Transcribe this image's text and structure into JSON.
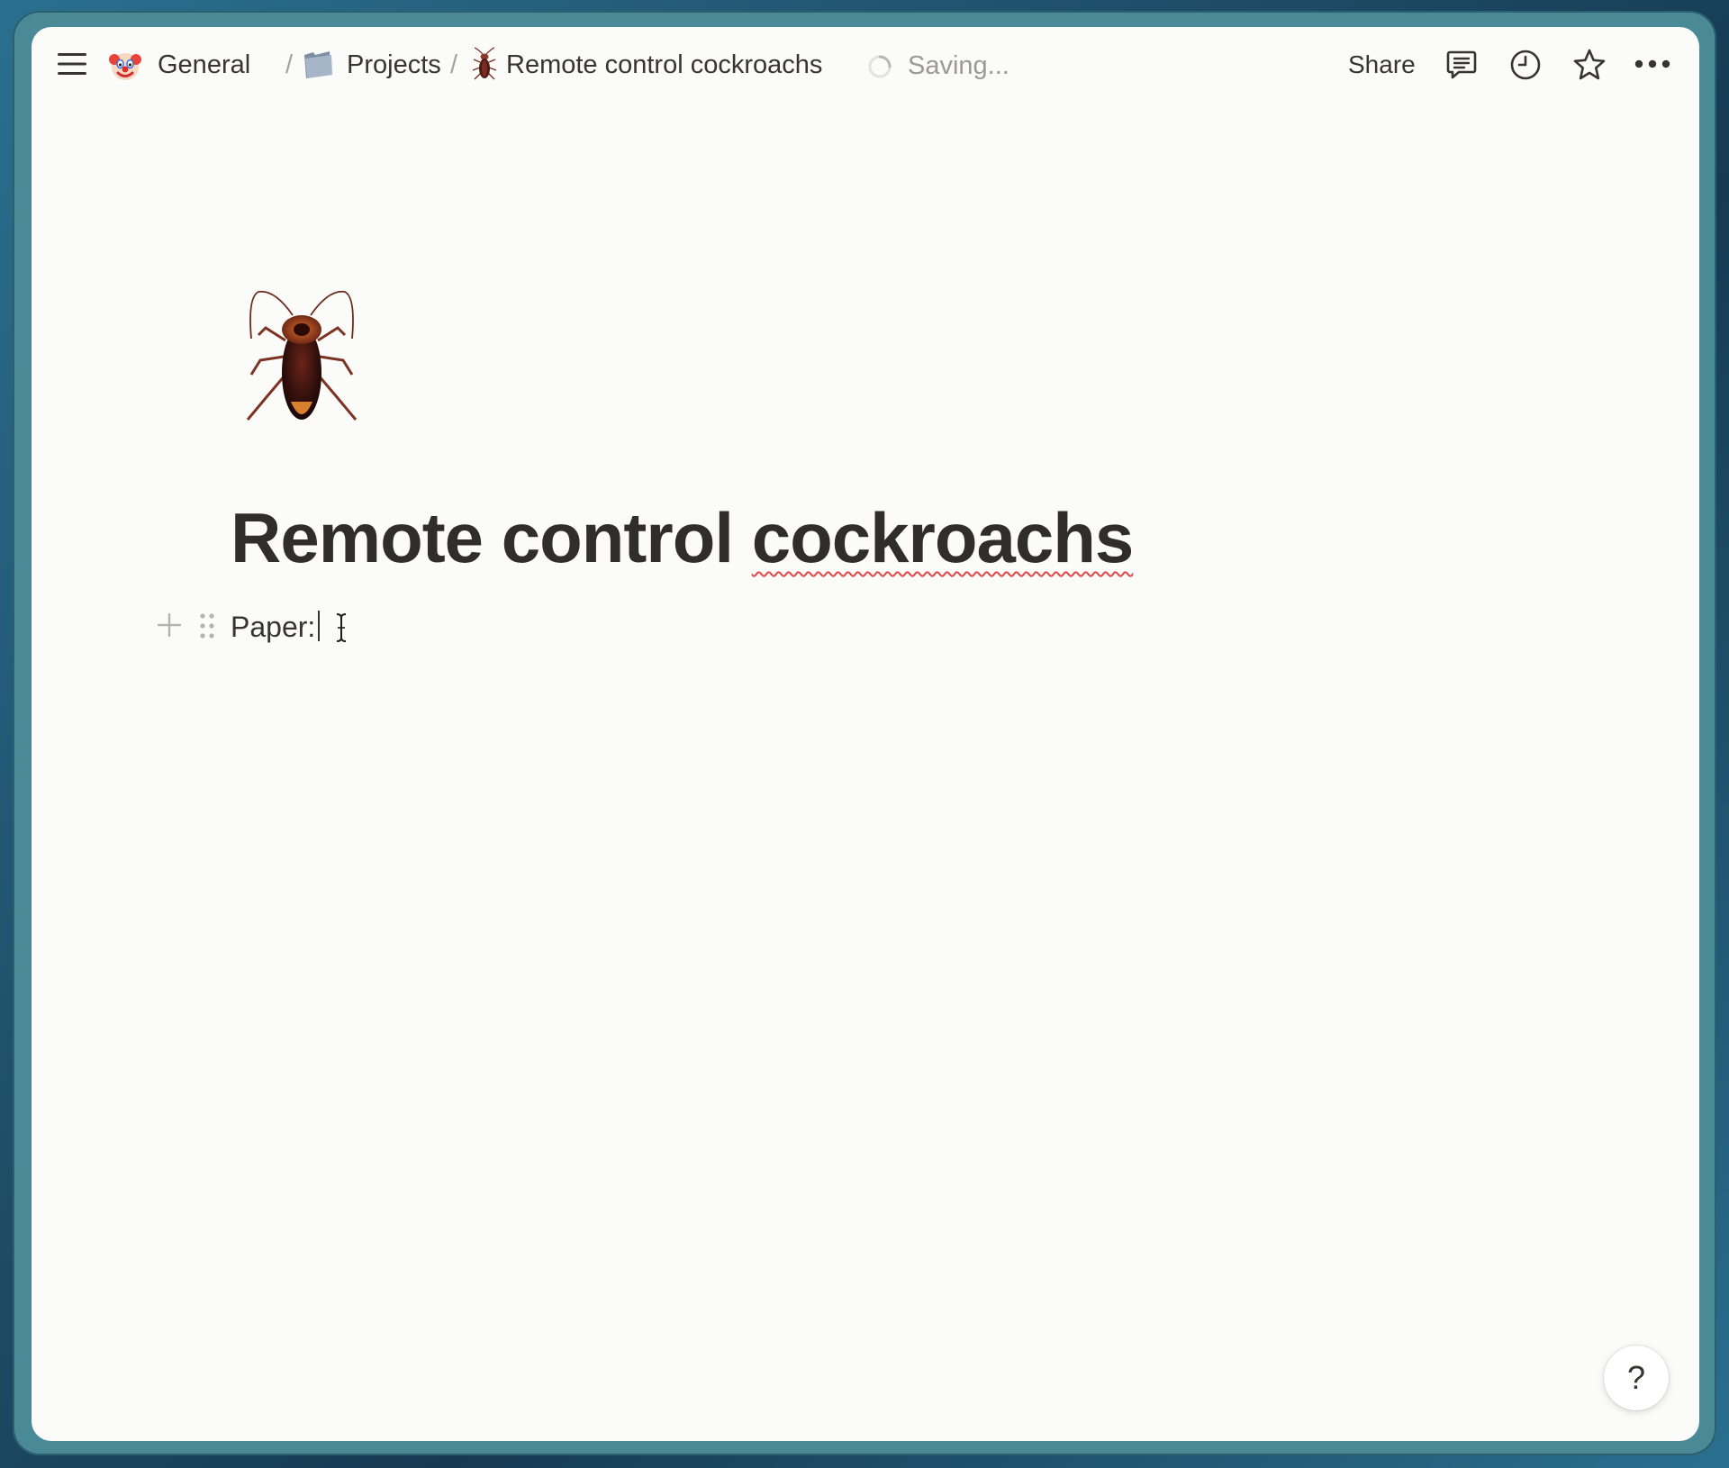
{
  "breadcrumb": {
    "items": [
      {
        "label": "General",
        "icon": "clown-face-emoji"
      },
      {
        "label": "Projects",
        "icon": "folder-icon"
      },
      {
        "label": "Remote control cockroachs",
        "icon": "cockroach-emoji"
      }
    ],
    "separator": "/"
  },
  "status": {
    "saving_label": "Saving..."
  },
  "topbar": {
    "share_label": "Share"
  },
  "page": {
    "icon": "cockroach-emoji",
    "title_part1": "Remote control ",
    "title_part2": "cockroachs",
    "block_text": "Paper:"
  },
  "help": {
    "label": "?"
  },
  "colors": {
    "window_bg": "#fbfbfa",
    "text": "#37352f",
    "muted": "#9b9a97",
    "spellcheck": "#e0484a"
  }
}
